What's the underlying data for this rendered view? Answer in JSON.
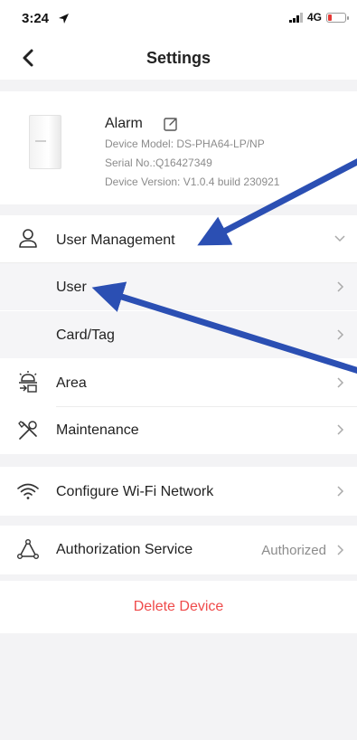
{
  "status_bar": {
    "time": "3:24",
    "network": "4G"
  },
  "nav": {
    "title": "Settings",
    "back_icon": "chevron-left-icon"
  },
  "device": {
    "name": "Alarm",
    "model": "Device Model: DS-PHA64-LP/NP",
    "serial": "Serial No.:Q16427349",
    "version": "Device Version: V1.0.4 build 230921"
  },
  "menu": {
    "user_management": {
      "label": "User Management",
      "icon": "user-icon",
      "chevron": "chevron-down-icon"
    },
    "user": {
      "label": "User"
    },
    "card_tag": {
      "label": "Card/Tag"
    },
    "area": {
      "label": "Area",
      "icon": "area-icon"
    },
    "maintenance": {
      "label": "Maintenance",
      "icon": "tools-icon"
    },
    "wifi": {
      "label": "Configure Wi-Fi Network",
      "icon": "wifi-icon"
    },
    "authorization": {
      "label": "Authorization Service",
      "value": "Authorized",
      "icon": "authorization-icon"
    }
  },
  "delete_label": "Delete Device",
  "colors": {
    "background": "#f3f3f5",
    "card": "#ffffff",
    "delete_text": "#ef4b4b",
    "annotation_arrow": "#2b4fb3"
  }
}
